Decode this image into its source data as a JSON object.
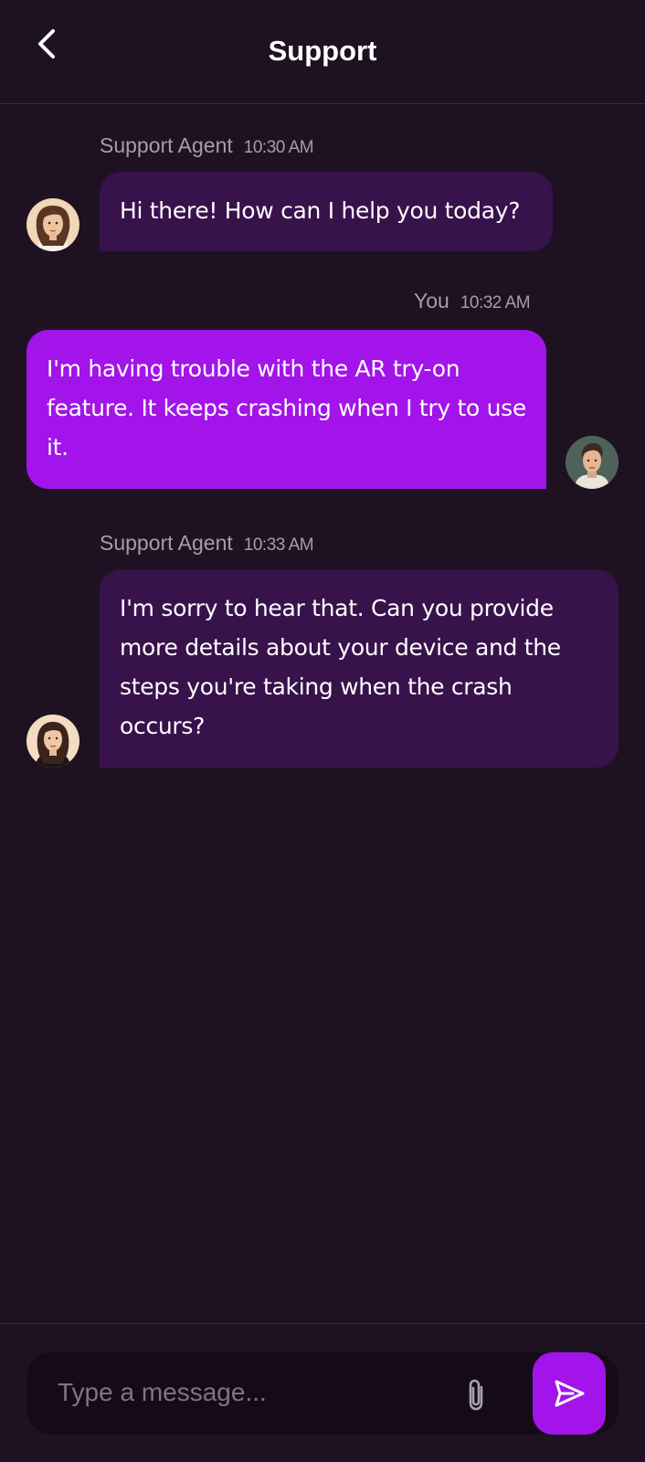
{
  "header": {
    "title": "Support",
    "back_icon": "chevron-left-icon"
  },
  "messages": [
    {
      "sender": "Support Agent",
      "time": "10:30 AM",
      "text": "Hi there! How can I help you today?",
      "from": "agent",
      "avatar_icon": "agent-avatar"
    },
    {
      "sender": "You",
      "time": "10:32 AM",
      "text": "I'm having trouble with the AR try-on feature. It keeps crashing when I try to use it.",
      "from": "user",
      "avatar_icon": "user-avatar"
    },
    {
      "sender": "Support Agent",
      "time": "10:33 AM",
      "text": "I'm sorry to hear that. Can you provide more details about your device and the steps you're taking when the crash occurs?",
      "from": "agent",
      "avatar_icon": "agent-avatar"
    }
  ],
  "composer": {
    "placeholder": "Type a message...",
    "value": "",
    "attach_icon": "paperclip-icon",
    "send_icon": "send-icon"
  },
  "colors": {
    "background": "#1e1222",
    "agent_bubble": "#38124b",
    "user_bubble": "#a214ea",
    "accent": "#a214ea",
    "meta_text": "#a79ca9",
    "composer_bg": "#150b18"
  }
}
